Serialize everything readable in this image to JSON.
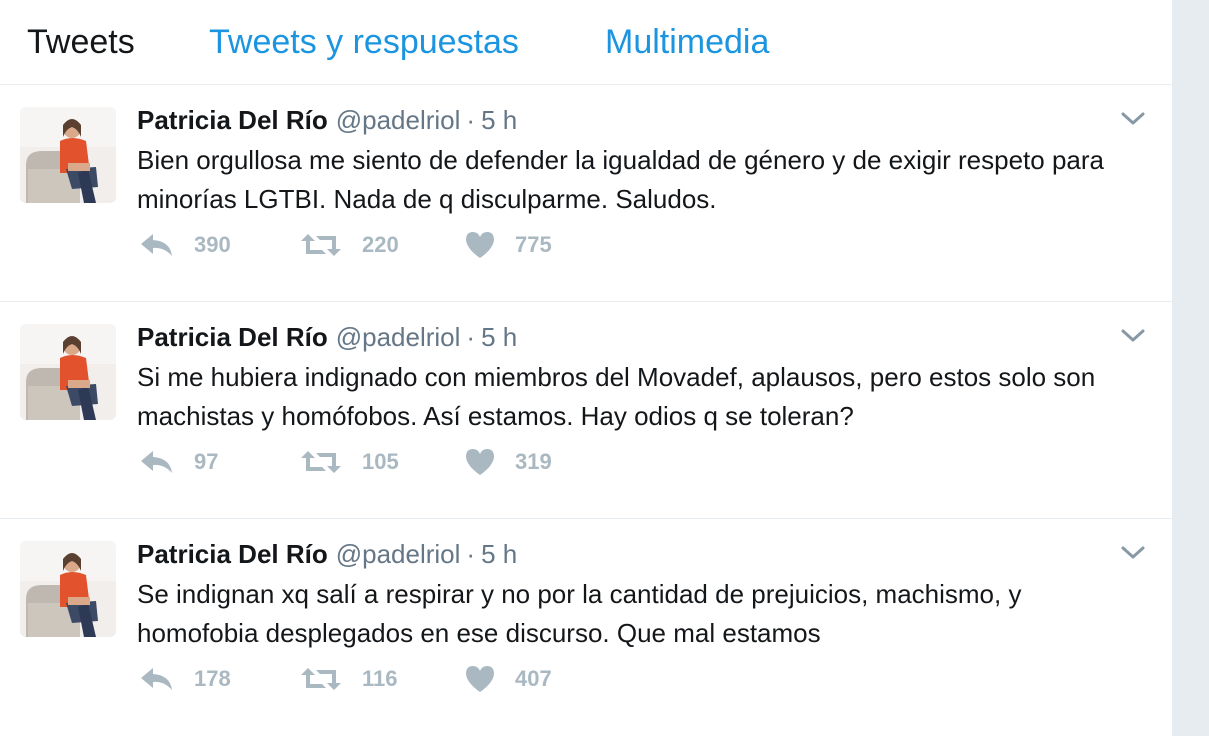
{
  "tabs": [
    {
      "label": "Tweets",
      "active": true
    },
    {
      "label": "Tweets y respuestas",
      "active": false
    },
    {
      "label": "Multimedia",
      "active": false
    }
  ],
  "colors": {
    "link": "#1b95e0",
    "text": "#14171a",
    "muted": "#657786",
    "action": "#aab8c2",
    "divider": "#e6ecf0"
  },
  "tweets": [
    {
      "name": "Patricia Del Río",
      "handle": "@padelriol",
      "separator": "·",
      "time": "5 h",
      "text": "Bien orgullosa me siento de defender la igualdad de género y de exigir respeto para minorías LGTBI. Nada de q disculparme. Saludos.",
      "replies": "390",
      "retweets": "220",
      "likes": "775"
    },
    {
      "name": "Patricia Del Río",
      "handle": "@padelriol",
      "separator": "·",
      "time": "5 h",
      "text": "Si me hubiera indignado con miembros del Movadef, aplausos, pero estos solo son machistas y homófobos. Así estamos. Hay odios q se toleran?",
      "replies": "97",
      "retweets": "105",
      "likes": "319"
    },
    {
      "name": "Patricia Del Río",
      "handle": "@padelriol",
      "separator": "·",
      "time": "5 h",
      "text": "Se indignan xq salí a respirar y no por la cantidad de prejuicios, machismo, y homofobia desplegados en ese discurso. Que mal estamos",
      "replies": "178",
      "retweets": "116",
      "likes": "407"
    }
  ],
  "icons": {
    "reply": "reply-icon",
    "retweet": "retweet-icon",
    "like": "heart-icon",
    "caret": "chevron-down-icon"
  }
}
